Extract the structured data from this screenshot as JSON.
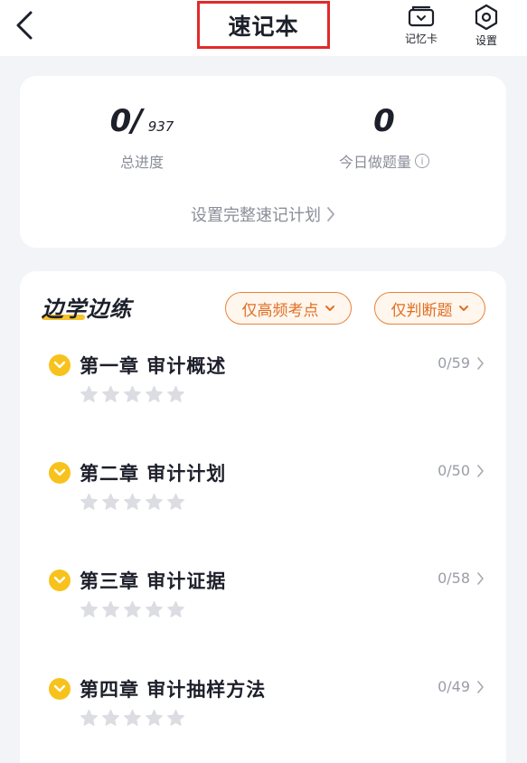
{
  "header": {
    "title": "速记本",
    "memory_card_label": "记忆卡",
    "settings_label": "设置"
  },
  "progress": {
    "total_done": "0/",
    "total_count": "937",
    "total_label": "总进度",
    "today_count": "0",
    "today_label": "今日做题量",
    "plan_link": "设置完整速记计划"
  },
  "section": {
    "title": "边学边练",
    "filter_high_freq": "仅高频考点",
    "filter_true_false": "仅判断题"
  },
  "chapters": [
    {
      "title": "第一章  审计概述",
      "progress": "0/59",
      "stars_filled": 0,
      "stars_total": 5
    },
    {
      "title": "第二章  审计计划",
      "progress": "0/50",
      "stars_filled": 0,
      "stars_total": 5
    },
    {
      "title": "第三章  审计证据",
      "progress": "0/58",
      "stars_filled": 0,
      "stars_total": 5
    },
    {
      "title": "第四章  审计抽样方法",
      "progress": "0/49",
      "stars_filled": 0,
      "stars_total": 5
    }
  ],
  "colors": {
    "accent_orange": "#e06f23",
    "check_yellow": "#f8c21c",
    "highlight_red": "#e12a2a",
    "star_empty": "#dcdde2"
  },
  "icons": {
    "back": "chevron-left-icon",
    "memory_card": "card-icon",
    "settings": "hexagon-gear-icon",
    "info": "info-icon",
    "chevron_right": "chevron-right-icon",
    "chevron_down": "chevron-down-icon",
    "check": "check-circle-icon",
    "star": "star-icon"
  }
}
